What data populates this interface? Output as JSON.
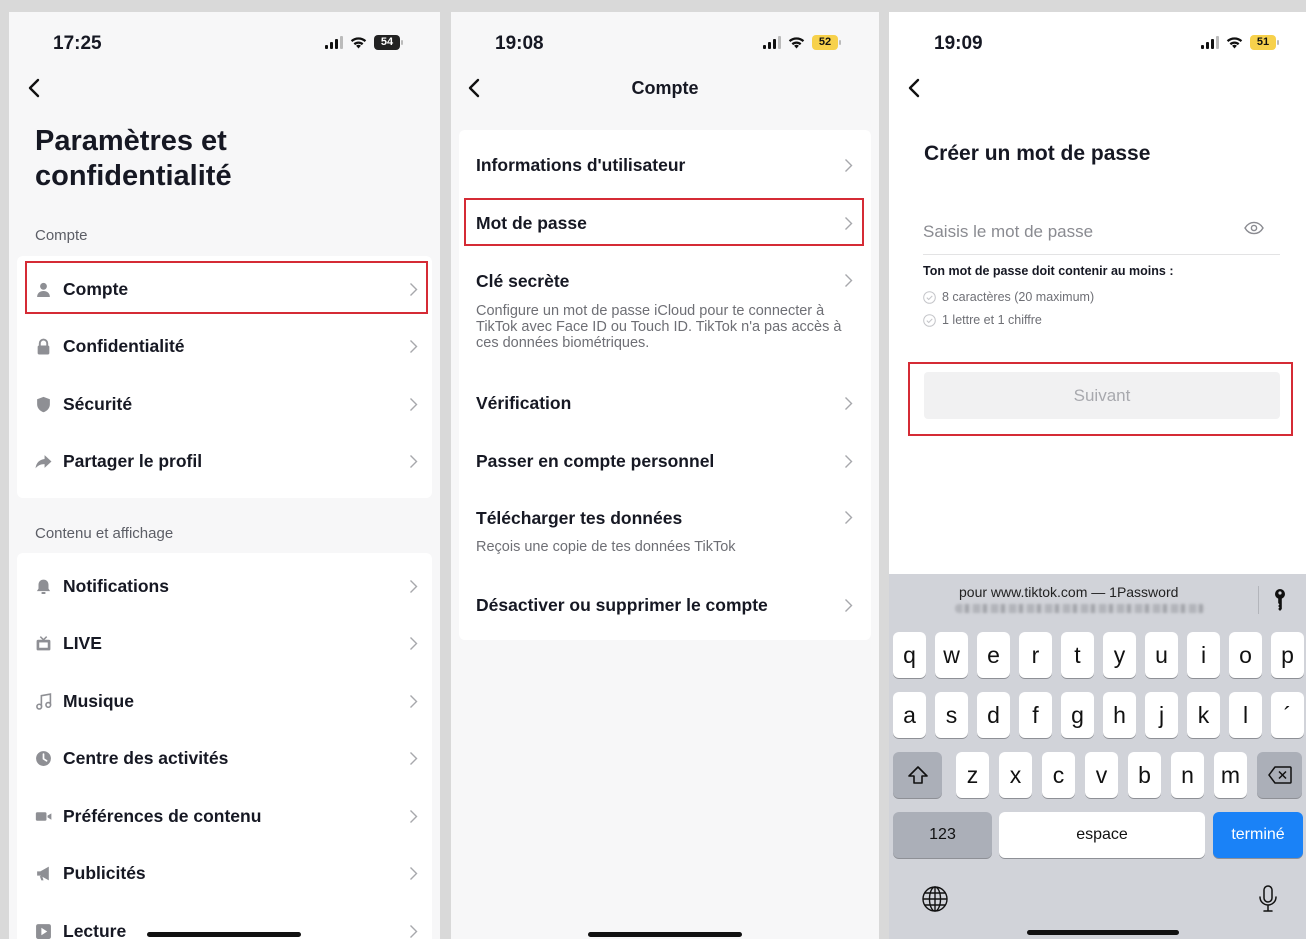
{
  "screen1": {
    "time": "17:25",
    "battery": "54",
    "title": "Paramètres et confidentialité",
    "section_account": "Compte",
    "account_items": [
      {
        "label": "Compte",
        "icon": "person-icon"
      },
      {
        "label": "Confidentialité",
        "icon": "lock-icon"
      },
      {
        "label": "Sécurité",
        "icon": "shield-icon"
      },
      {
        "label": "Partager le profil",
        "icon": "share-icon"
      }
    ],
    "section_content": "Contenu et affichage",
    "content_items": [
      {
        "label": "Notifications",
        "icon": "bell-icon"
      },
      {
        "label": "LIVE",
        "icon": "tv-icon"
      },
      {
        "label": "Musique",
        "icon": "music-note-icon"
      },
      {
        "label": "Centre des activités",
        "icon": "clock-icon"
      },
      {
        "label": "Préférences de contenu",
        "icon": "video-camera-icon"
      },
      {
        "label": "Publicités",
        "icon": "megaphone-icon"
      },
      {
        "label": "Lecture",
        "icon": "play-icon"
      }
    ]
  },
  "screen2": {
    "time": "19:08",
    "battery": "52",
    "title": "Compte",
    "items": [
      {
        "label": "Informations d'utilisateur",
        "desc": ""
      },
      {
        "label": "Mot de passe",
        "desc": ""
      },
      {
        "label": "Clé secrète",
        "desc": "Configure un mot de passe iCloud pour te connecter à TikTok avec Face ID ou Touch ID. TikTok n'a pas accès à ces données biométriques."
      },
      {
        "label": "Vérification",
        "desc": ""
      },
      {
        "label": "Passer en compte personnel",
        "desc": ""
      },
      {
        "label": "Télécharger tes données",
        "desc": "Reçois une copie de tes données TikTok"
      },
      {
        "label": "Désactiver ou supprimer le compte",
        "desc": ""
      }
    ]
  },
  "screen3": {
    "time": "19:09",
    "battery": "51",
    "title": "Créer un mot de passe",
    "password_placeholder": "Saisis le mot de passe",
    "password_value": "",
    "requirements_title": "Ton mot de passe doit contenir au moins :",
    "requirements": [
      "8 caractères (20 maximum)",
      "1 lettre et 1 chiffre"
    ],
    "next_label": "Suivant",
    "keyboard": {
      "autofill_text": "pour www.tiktok.com — 1Password",
      "row1": [
        "q",
        "w",
        "e",
        "r",
        "t",
        "y",
        "u",
        "i",
        "o",
        "p"
      ],
      "row2": [
        "a",
        "s",
        "d",
        "f",
        "g",
        "h",
        "j",
        "k",
        "l",
        "´"
      ],
      "row3": [
        "z",
        "x",
        "c",
        "v",
        "b",
        "n",
        "m"
      ],
      "numbers_label": "123",
      "space_label": "espace",
      "done_label": "terminé"
    }
  },
  "colors": {
    "highlight": "#d52b35",
    "keyboard_done": "#1a82f7",
    "battery": "#f7d14b"
  }
}
